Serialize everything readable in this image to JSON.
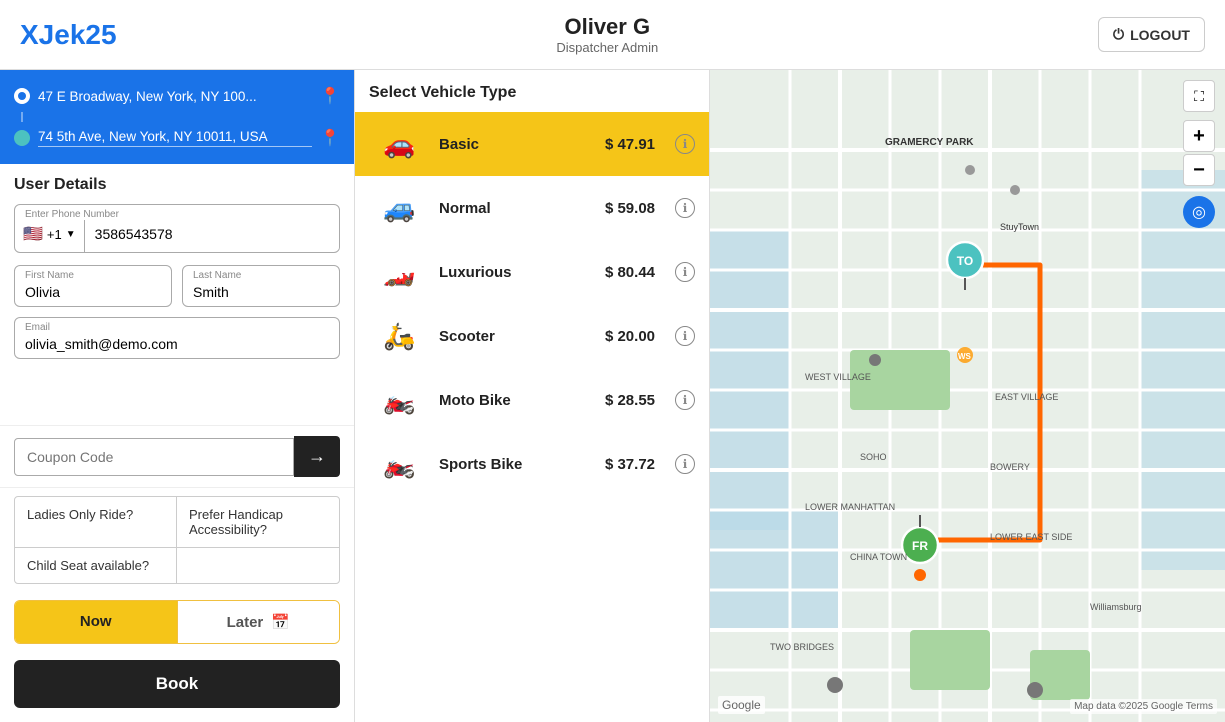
{
  "header": {
    "logo_text": "XJek",
    "logo_number": "25",
    "username": "Oliver G",
    "role": "Dispatcher Admin",
    "logout_label": "LOGOUT"
  },
  "address": {
    "from": "47 E Broadway, New York, NY 100...",
    "to": "74 5th Ave, New York, NY 10011, USA"
  },
  "user_details": {
    "title": "User Details",
    "phone_label": "Enter Phone Number",
    "country_code": "+1",
    "country_flag": "🇺🇸",
    "phone_number": "3586543578",
    "first_name_label": "First Name",
    "first_name": "Olivia",
    "last_name_label": "Last Name",
    "last_name": "Smith",
    "email_label": "Email",
    "email": "olivia_smith@demo.com"
  },
  "vehicle_section": {
    "title": "Select Vehicle Type",
    "vehicles": [
      {
        "id": "basic",
        "name": "Basic",
        "price": "$ 47.91",
        "icon": "🚗",
        "selected": true
      },
      {
        "id": "normal",
        "name": "Normal",
        "price": "$ 59.08",
        "icon": "🚙",
        "selected": false
      },
      {
        "id": "luxurious",
        "name": "Luxurious",
        "price": "$ 80.44",
        "icon": "🏎️",
        "selected": false
      },
      {
        "id": "scooter",
        "name": "Scooter",
        "price": "$ 20.00",
        "icon": "🛵",
        "selected": false
      },
      {
        "id": "motobike",
        "name": "Moto Bike",
        "price": "$ 28.55",
        "icon": "🏍️",
        "selected": false
      },
      {
        "id": "sportsbike",
        "name": "Sports Bike",
        "price": "$ 37.72",
        "icon": "🏍️",
        "selected": false
      }
    ]
  },
  "coupon": {
    "placeholder": "Coupon Code",
    "button_icon": "→"
  },
  "options": {
    "ladies_only": "Ladies Only Ride?",
    "handicap": "Prefer Handicap Accessibility?",
    "child_seat": "Child Seat available?"
  },
  "time": {
    "now_label": "Now",
    "later_label": "Later"
  },
  "book_label": "Book",
  "map": {
    "marker_to": "TO",
    "marker_fr": "FR"
  }
}
